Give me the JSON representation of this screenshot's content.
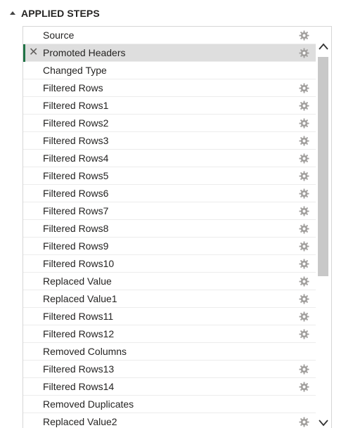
{
  "panel": {
    "title": "APPLIED STEPS"
  },
  "steps": [
    {
      "label": "Source",
      "settings": true,
      "selected": false
    },
    {
      "label": "Promoted Headers",
      "settings": true,
      "selected": true
    },
    {
      "label": "Changed Type",
      "settings": false,
      "selected": false
    },
    {
      "label": "Filtered Rows",
      "settings": true,
      "selected": false
    },
    {
      "label": "Filtered Rows1",
      "settings": true,
      "selected": false
    },
    {
      "label": "Filtered Rows2",
      "settings": true,
      "selected": false
    },
    {
      "label": "Filtered Rows3",
      "settings": true,
      "selected": false
    },
    {
      "label": "Filtered Rows4",
      "settings": true,
      "selected": false
    },
    {
      "label": "Filtered Rows5",
      "settings": true,
      "selected": false
    },
    {
      "label": "Filtered Rows6",
      "settings": true,
      "selected": false
    },
    {
      "label": "Filtered Rows7",
      "settings": true,
      "selected": false
    },
    {
      "label": "Filtered Rows8",
      "settings": true,
      "selected": false
    },
    {
      "label": "Filtered Rows9",
      "settings": true,
      "selected": false
    },
    {
      "label": "Filtered Rows10",
      "settings": true,
      "selected": false
    },
    {
      "label": "Replaced Value",
      "settings": true,
      "selected": false
    },
    {
      "label": "Replaced Value1",
      "settings": true,
      "selected": false
    },
    {
      "label": "Filtered Rows11",
      "settings": true,
      "selected": false
    },
    {
      "label": "Filtered Rows12",
      "settings": true,
      "selected": false
    },
    {
      "label": "Removed Columns",
      "settings": false,
      "selected": false
    },
    {
      "label": "Filtered Rows13",
      "settings": true,
      "selected": false
    },
    {
      "label": "Filtered Rows14",
      "settings": true,
      "selected": false
    },
    {
      "label": "Removed Duplicates",
      "settings": false,
      "selected": false
    },
    {
      "label": "Replaced Value2",
      "settings": true,
      "selected": false
    }
  ],
  "icons": {
    "delete": "close-icon",
    "settings": "gear-icon",
    "collapse": "triangle-up-icon",
    "scroll_up": "chevron-up-icon",
    "scroll_down": "chevron-down-icon"
  },
  "colors": {
    "selected_background": "#dedede",
    "active_indicator": "#217346",
    "text": "#252423",
    "icon": "#8a8886",
    "scroll_thumb": "#c8c8c8"
  }
}
